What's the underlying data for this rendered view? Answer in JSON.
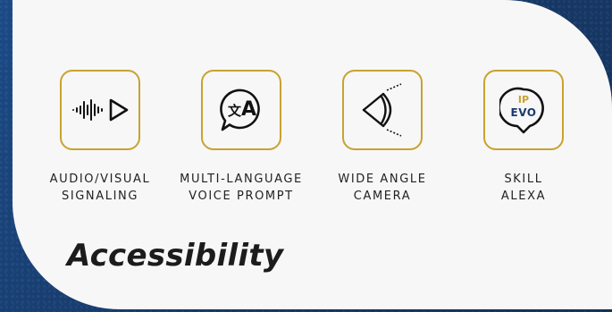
{
  "features": [
    {
      "icon": "audio-wave-play-icon",
      "line1": "AUDIO/VISUAL",
      "line2": "SIGNALING"
    },
    {
      "icon": "translate-bubble-icon",
      "line1": "MULTI-LANGUAGE",
      "line2": "VOICE PROMPT",
      "glyph_a": "文",
      "glyph_b": "A"
    },
    {
      "icon": "eye-camera-icon",
      "line1": "WIDE ANGLE",
      "line2": "CAMERA"
    },
    {
      "icon": "alexa-ip-evo-icon",
      "line1": "SKILL",
      "line2": "ALEXA",
      "badge_top": "IP",
      "badge_bottom": "EVO"
    }
  ],
  "title": "Accessibility",
  "colors": {
    "accent": "#c8a230",
    "background": "#183f73",
    "card": "#f7f7f7",
    "text": "#222222"
  }
}
